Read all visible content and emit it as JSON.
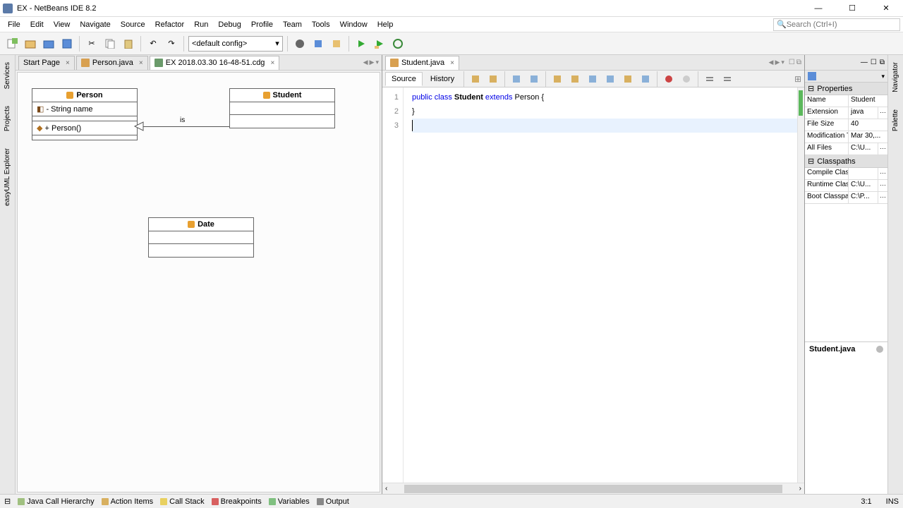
{
  "titlebar": {
    "title": "EX - NetBeans IDE 8.2"
  },
  "menu": [
    "File",
    "Edit",
    "View",
    "Navigate",
    "Source",
    "Refactor",
    "Run",
    "Debug",
    "Profile",
    "Team",
    "Tools",
    "Window",
    "Help"
  ],
  "search_placeholder": "Search (Ctrl+I)",
  "config_combo": "<default config>",
  "tabs_left": [
    {
      "label": "Start Page",
      "closable": true
    },
    {
      "label": "Person.java",
      "closable": true
    },
    {
      "label": "EX 2018.03.30 16-48-51.cdg",
      "closable": true
    }
  ],
  "tab_right": {
    "label": "Student.java"
  },
  "uml": {
    "person": {
      "name": "Person",
      "field": "- String name",
      "method": "+ Person()"
    },
    "student": {
      "name": "Student"
    },
    "date": {
      "name": "Date"
    },
    "relation_label": "is"
  },
  "code_toolbar": {
    "source": "Source",
    "history": "History"
  },
  "code": {
    "line1_pre": "public class ",
    "line1_name": "Student",
    "line1_mid": " extends ",
    "line1_parent": "Person",
    "line1_post": " {",
    "line2": "}",
    "gutter": [
      "1",
      "2",
      "3"
    ]
  },
  "props": {
    "title": "Properties",
    "rows": [
      {
        "k": "Name",
        "v": "Student"
      },
      {
        "k": "Extension",
        "v": "java",
        "btn": true
      },
      {
        "k": "File Size",
        "v": "40"
      },
      {
        "k": "Modification T",
        "v": "Mar 30,..."
      },
      {
        "k": "All Files",
        "v": "C:\\U...",
        "btn": true
      }
    ],
    "cp_title": "Classpaths",
    "cp_rows": [
      {
        "k": "Compile Class",
        "v": "",
        "btn": true
      },
      {
        "k": "Runtime Class",
        "v": "C:\\U...",
        "btn": true
      },
      {
        "k": "Boot Classpa",
        "v": "C:\\P...",
        "btn": true
      }
    ],
    "nav_file": "Student.java"
  },
  "leftbar": [
    "Services",
    "Projects",
    "easyUML Explorer"
  ],
  "rightbar": [
    "Navigator",
    "Palette"
  ],
  "status": {
    "items": [
      "Java Call Hierarchy",
      "Action Items",
      "Call Stack",
      "Breakpoints",
      "Variables",
      "Output"
    ],
    "pos": "3:1",
    "mode": "INS"
  }
}
